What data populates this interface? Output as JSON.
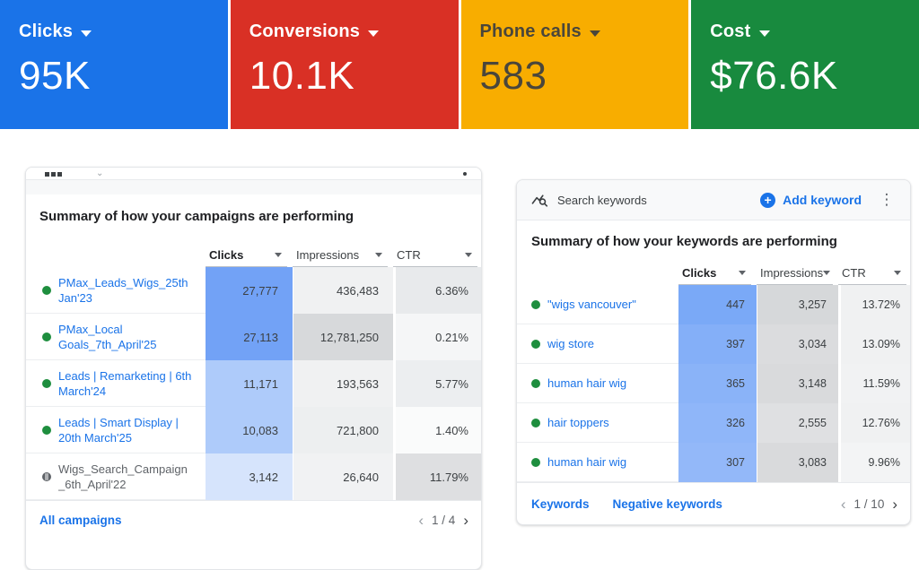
{
  "scorecards": [
    {
      "label": "Clicks",
      "value": "95K",
      "bg": "#1a73e8",
      "fg": "#ffffff"
    },
    {
      "label": "Conversions",
      "value": "10.1K",
      "bg": "#d93025",
      "fg": "#ffffff"
    },
    {
      "label": "Phone calls",
      "value": "583",
      "bg": "#f8ad00",
      "fg": "#4a463b"
    },
    {
      "label": "Cost",
      "value": "$76.6K",
      "bg": "#188a3e",
      "fg": "#ffffff"
    }
  ],
  "campaigns": {
    "title": "Summary of how your campaigns are performing",
    "columns": {
      "clicks": "Clicks",
      "impressions": "Impressions",
      "ctr": "CTR"
    },
    "rows": [
      {
        "status": "enabled",
        "name": "PMax_Leads_Wigs_25th Jan'23",
        "clicks": "27,777",
        "impressions": "436,483",
        "ctr": "6.36%",
        "clicks_bg": "#72a2f6",
        "impressions_bg": "#f0f1f2",
        "ctr_bg": "#e8eaec"
      },
      {
        "status": "enabled",
        "name": "PMax_Local Goals_7th_April'25",
        "clicks": "27,113",
        "impressions": "12,781,250",
        "ctr": "0.21%",
        "clicks_bg": "#72a2f6",
        "impressions_bg": "#d7d9db",
        "ctr_bg": "#f5f6f7"
      },
      {
        "status": "enabled",
        "name": "Leads | Remarketing | 6th March'24",
        "clicks": "11,171",
        "impressions": "193,563",
        "ctr": "5.77%",
        "clicks_bg": "#aecbfa",
        "impressions_bg": "#f0f1f2",
        "ctr_bg": "#eceef0"
      },
      {
        "status": "enabled",
        "name": "Leads | Smart Display | 20th March'25",
        "clicks": "10,083",
        "impressions": "721,800",
        "ctr": "1.40%",
        "clicks_bg": "#aecbfa",
        "impressions_bg": "#edeff0",
        "ctr_bg": "#fafbfb"
      },
      {
        "status": "paused",
        "name": "Wigs_Search_Campaign _6th_April'22",
        "clicks": "3,142",
        "impressions": "26,640",
        "ctr": "11.79%",
        "clicks_bg": "#d6e4fc",
        "impressions_bg": "#f1f2f3",
        "ctr_bg": "#dedfe1"
      }
    ],
    "footer_link": "All campaigns",
    "pagination": "1 / 4"
  },
  "keywords": {
    "toolbar_title": "Search keywords",
    "add_button": "Add keyword",
    "title": "Summary of how your keywords are performing",
    "columns": {
      "clicks": "Clicks",
      "impressions": "Impressions",
      "ctr": "CTR"
    },
    "rows": [
      {
        "status": "enabled",
        "name": "\"wigs vancouver\"",
        "clicks": "447",
        "impressions": "3,257",
        "ctr": "13.72%",
        "clicks_bg": "#7aa9f7",
        "impressions_bg": "#d6d8da",
        "ctr_bg": "#f0f1f2"
      },
      {
        "status": "enabled",
        "name": "wig store",
        "clicks": "397",
        "impressions": "3,034",
        "ctr": "13.09%",
        "clicks_bg": "#84aff8",
        "impressions_bg": "#dbdcde",
        "ctr_bg": "#f0f1f2"
      },
      {
        "status": "enabled",
        "name": "human hair wig",
        "clicks": "365",
        "impressions": "3,148",
        "ctr": "11.59%",
        "clicks_bg": "#8ab3f8",
        "impressions_bg": "#d9dadc",
        "ctr_bg": "#f1f2f3"
      },
      {
        "status": "enabled",
        "name": "hair toppers",
        "clicks": "326",
        "impressions": "2,555",
        "ctr": "12.76%",
        "clicks_bg": "#8fb6f9",
        "impressions_bg": "#dfe0e2",
        "ctr_bg": "#f0f1f2"
      },
      {
        "status": "enabled",
        "name": "human hair wig",
        "clicks": "307",
        "impressions": "3,083",
        "ctr": "9.96%",
        "clicks_bg": "#93b8f9",
        "impressions_bg": "#d9dadc",
        "ctr_bg": "#f3f4f5"
      }
    ],
    "tabs": [
      "Keywords",
      "Negative keywords"
    ],
    "pagination": "1 / 10"
  }
}
